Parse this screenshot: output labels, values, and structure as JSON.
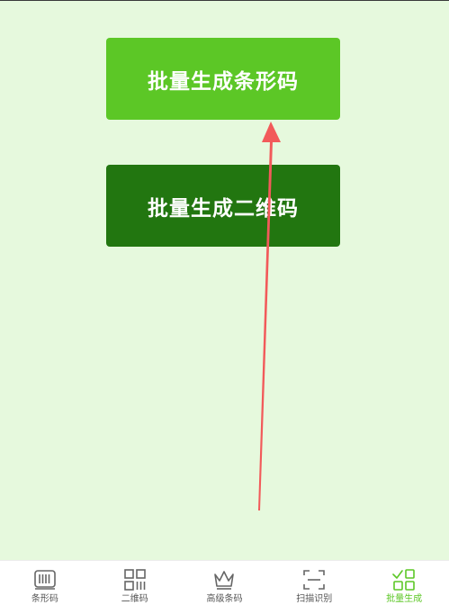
{
  "buttons": {
    "batch_barcode": "批量生成条形码",
    "batch_qrcode": "批量生成二维码"
  },
  "tabbar": {
    "items": [
      {
        "label": "条形码",
        "icon": "barcode-icon"
      },
      {
        "label": "二维码",
        "icon": "qrcode-icon"
      },
      {
        "label": "高级条码",
        "icon": "crown-icon"
      },
      {
        "label": "扫描识别",
        "icon": "scan-icon"
      },
      {
        "label": "批量生成",
        "icon": "batch-icon",
        "active": true
      }
    ]
  },
  "colors": {
    "background": "#e6f9dd",
    "primary_green": "#5cc726",
    "dark_green": "#227610",
    "arrow_red": "#f25a5a",
    "tab_inactive": "#555555"
  }
}
